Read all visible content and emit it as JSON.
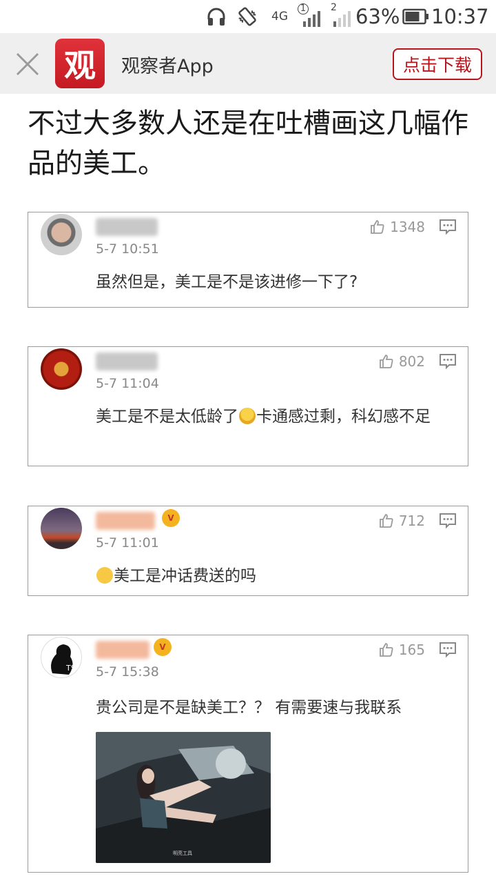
{
  "status_bar": {
    "network": "4G",
    "sim1": "1",
    "sim2": "2",
    "battery": "63%",
    "time": "10:37"
  },
  "banner": {
    "logo_text": "观",
    "app_name": "观察者App",
    "download_label": "点击下载"
  },
  "article": {
    "headline": "不过大多数人还是在吐槽画这几幅作品的美工。"
  },
  "comments": [
    {
      "time": "5-7 10:51",
      "likes": "1348",
      "text": "虽然但是，美工是不是该进修一下了?"
    },
    {
      "time": "5-7 11:04",
      "likes": "802",
      "text_before_emoji": "美工是不是太低龄了",
      "emoji_icon": "crying-laughing-emoji",
      "text_after_emoji": "卡通感过剩，科幻感不足"
    },
    {
      "time": "5-7 11:01",
      "likes": "712",
      "emoji_icon": "shocked-emoji",
      "text": "美工是冲话费送的吗"
    },
    {
      "time": "5-7 15:38",
      "likes": "165",
      "text": "贵公司是不是缺美工？？ 有需要速与我联系",
      "image_caption": "明亮工具"
    }
  ],
  "colors": {
    "brand_red": "#c41a22",
    "banner_bg": "#efefef",
    "muted_text": "#888888"
  }
}
